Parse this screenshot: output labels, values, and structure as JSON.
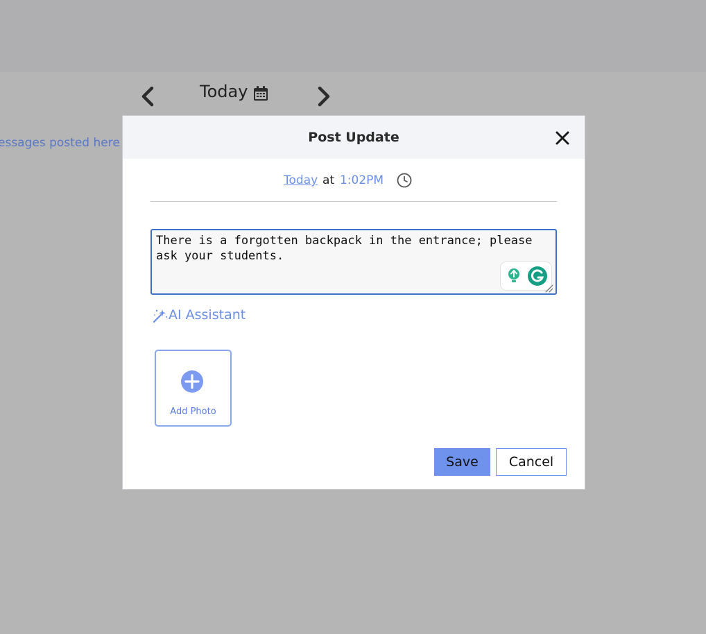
{
  "app": {
    "date_label": "Today",
    "background_message": "essages posted here ar"
  },
  "icons": {
    "prev": "chevron-left-icon",
    "next": "chevron-right-icon",
    "calendar": "calendar-icon",
    "close": "close-icon",
    "clock": "clock-icon",
    "ai": "magic-wand-icon",
    "add": "plus-circle-icon",
    "grammarly_bulb": "lightbulb-icon",
    "grammarly_logo": "grammarly-icon"
  },
  "modal": {
    "title": "Post Update",
    "when": {
      "date": "Today",
      "at": "at",
      "time": "1:02PM"
    },
    "message_value": "There is a forgotten backpack in the entrance; please ask your students.",
    "ai_assistant_label": "AI Assistant",
    "add_photo_label": "Add Photo",
    "save_label": "Save",
    "cancel_label": "Cancel"
  },
  "colors": {
    "accent": "#6f93ec",
    "link": "#6a8ee6",
    "overlay": "#b5b5b5",
    "textarea_border": "#3d6fc7",
    "grammarly_green": "#15a085"
  }
}
